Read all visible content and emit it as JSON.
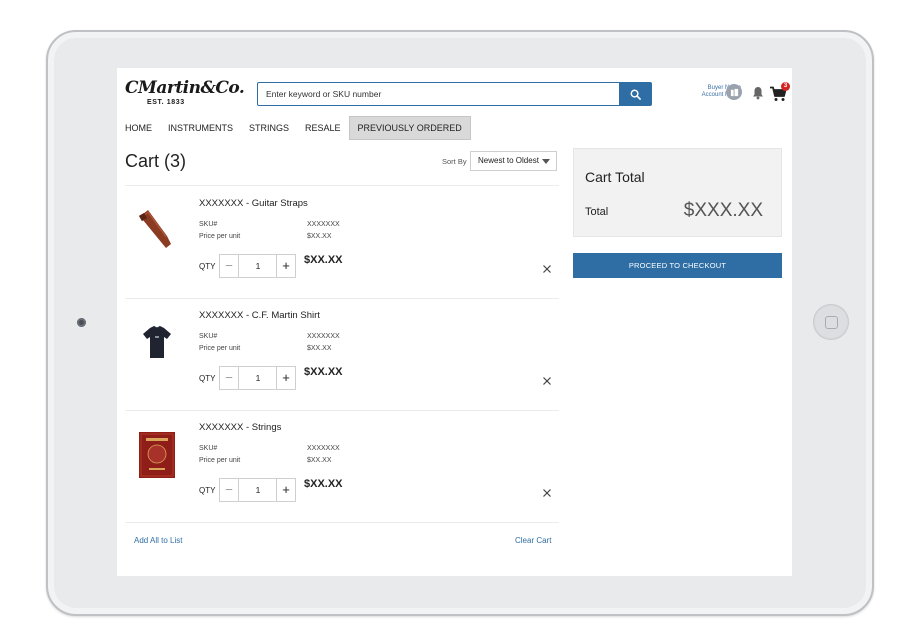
{
  "brand": {
    "script": "CMartin&Co.",
    "est": "EST. 1833"
  },
  "search": {
    "placeholder": "Enter keyword or SKU number",
    "icon": "search-icon"
  },
  "account": {
    "buyer_name": "Buyer Name",
    "account_name": "Account Name"
  },
  "cart_badge": "3",
  "nav": {
    "items": [
      {
        "label": "HOME"
      },
      {
        "label": "INSTRUMENTS"
      },
      {
        "label": "STRINGS"
      },
      {
        "label": "RESALE"
      },
      {
        "label": "PREVIOUSLY ORDERED",
        "active": true
      }
    ]
  },
  "cart": {
    "title": "Cart (3)",
    "sort_label": "Sort By",
    "sort_value": "Newest to Oldest",
    "items": [
      {
        "name": "XXXXXXX - Guitar Straps",
        "sku_label": "SKU#",
        "sku": "XXXXXXX",
        "price_label": "Price per unit",
        "price": "$XX.XX",
        "qty_label": "QTY",
        "qty": "1",
        "total": "$XX.XX",
        "thumb": "guitar-strap"
      },
      {
        "name": "XXXXXXX - C.F. Martin Shirt",
        "sku_label": "SKU#",
        "sku": "XXXXXXX",
        "price_label": "Price per unit",
        "price": "$XX.XX",
        "qty_label": "QTY",
        "qty": "1",
        "total": "$XX.XX",
        "thumb": "t-shirt"
      },
      {
        "name": "XXXXXXX - Strings",
        "sku_label": "SKU#",
        "sku": "XXXXXXX",
        "price_label": "Price per unit",
        "price": "$XX.XX",
        "qty_label": "QTY",
        "qty": "1",
        "total": "$XX.XX",
        "thumb": "string-pack"
      }
    ],
    "add_all": "Add All to List",
    "clear": "Clear Cart"
  },
  "summary": {
    "heading": "Cart Total",
    "total_label": "Total",
    "total_value": "$XXX.XX",
    "checkout": "PROCEED TO CHECKOUT"
  },
  "colors": {
    "accent": "#2f6ea5",
    "badge": "#d32424",
    "panel": "#f2f2f2"
  }
}
